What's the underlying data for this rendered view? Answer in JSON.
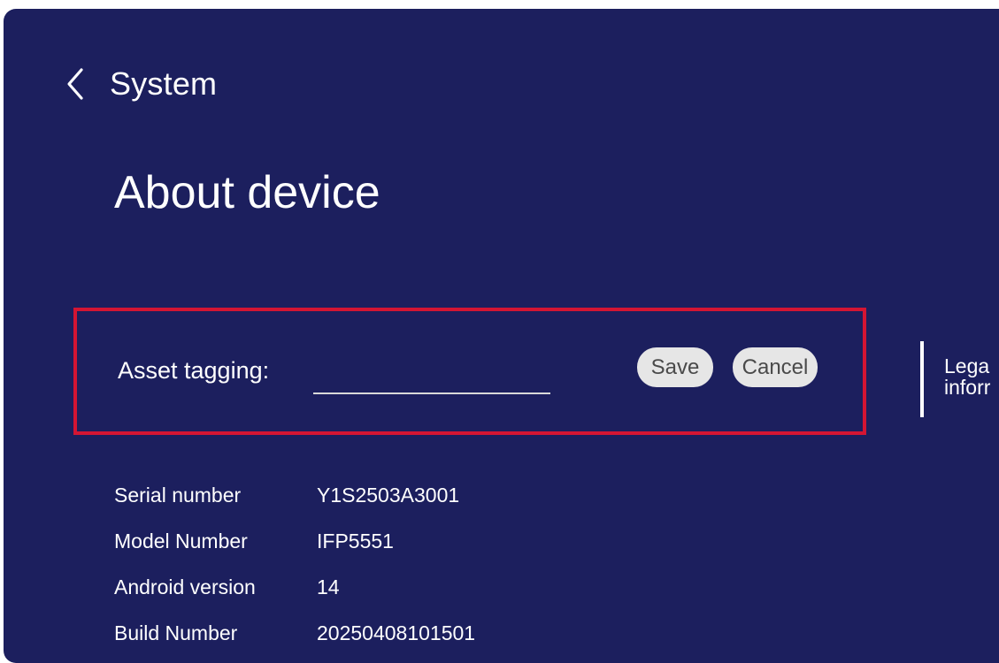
{
  "header": {
    "back_label": "System",
    "back_icon": "chevron-left-icon"
  },
  "page": {
    "title": "About device"
  },
  "asset_tagging": {
    "label": "Asset tagging:",
    "value": "",
    "placeholder": "",
    "save_label": "Save",
    "cancel_label": "Cancel",
    "highlight_color": "#d41533"
  },
  "side_menu": {
    "legal_line1": "Lega",
    "legal_line2": "inforr"
  },
  "info": [
    {
      "label": "Serial number",
      "value": "Y1S2503A3001"
    },
    {
      "label": "Model Number",
      "value": "IFP5551"
    },
    {
      "label": "Android version",
      "value": "14"
    },
    {
      "label": "Build Number",
      "value": "20250408101501"
    }
  ],
  "colors": {
    "background": "#1c1f5e",
    "text": "#ffffff",
    "button_bg": "#e6e6e6",
    "button_text": "#4a4a4a"
  }
}
